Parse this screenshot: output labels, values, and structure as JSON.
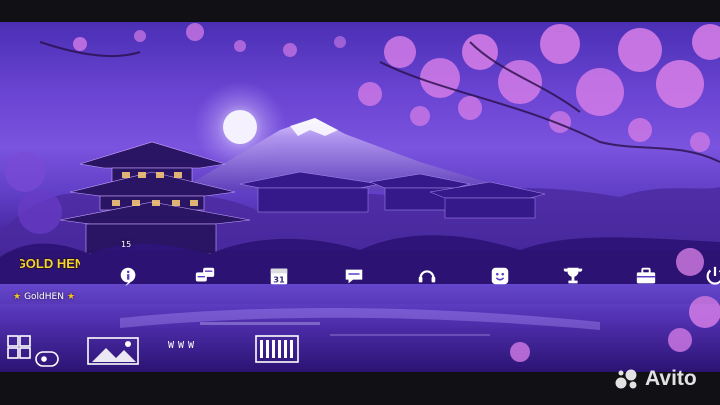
{
  "homescreen": {
    "profile": {
      "logo_text": "GOLD HEN",
      "username": "GoldHEN"
    },
    "notification_count": "15",
    "function_bar": [
      {
        "name": "goldhen-logo",
        "icon": "goldhen-logo"
      },
      {
        "name": "whats-new-icon",
        "icon": "info-icon"
      },
      {
        "name": "messages-icon",
        "icon": "chat-bubbles-icon"
      },
      {
        "name": "events-icon",
        "icon": "calendar-icon",
        "label": "31"
      },
      {
        "name": "notifications-icon",
        "icon": "speech-bubble-icon"
      },
      {
        "name": "party-icon",
        "icon": "headset-icon"
      },
      {
        "name": "profile-icon",
        "icon": "smiley-icon"
      },
      {
        "name": "trophies-icon",
        "icon": "trophy-icon"
      },
      {
        "name": "settings-icon",
        "icon": "toolbox-icon"
      },
      {
        "name": "power-icon",
        "icon": "power-icon"
      }
    ],
    "content_row": [
      {
        "name": "library-tile",
        "icon": "library-icon"
      },
      {
        "name": "media-gallery-tile",
        "icon": "gallery-icon"
      },
      {
        "name": "web-browser-tile",
        "icon": "www-icon",
        "label": "WWW"
      },
      {
        "name": "tv-video-tile",
        "icon": "tv-icon"
      }
    ]
  },
  "colors": {
    "accent": "#f3c11d",
    "sky_top": "#4a2fb4",
    "sky_glow": "#7a53de",
    "blossom": "#d27be6",
    "water": "#3a1d8c"
  },
  "watermark": {
    "text": "Avito"
  }
}
